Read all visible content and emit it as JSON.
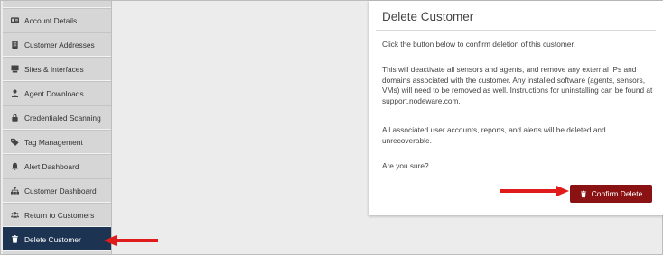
{
  "sidebar": {
    "items": [
      {
        "label": "Account Details",
        "icon": "id-card-icon"
      },
      {
        "label": "Customer Addresses",
        "icon": "document-icon"
      },
      {
        "label": "Sites & Interfaces",
        "icon": "server-icon"
      },
      {
        "label": "Agent Downloads",
        "icon": "user-icon"
      },
      {
        "label": "Credentialed Scanning",
        "icon": "lock-icon"
      },
      {
        "label": "Tag Management",
        "icon": "tags-icon"
      },
      {
        "label": "Alert Dashboard",
        "icon": "bell-icon"
      },
      {
        "label": "Customer Dashboard",
        "icon": "sitemap-icon"
      },
      {
        "label": "Return to Customers",
        "icon": "users-icon"
      },
      {
        "label": "Delete Customer",
        "icon": "trash-icon",
        "active": true
      }
    ],
    "active_color": "#1d3352"
  },
  "panel": {
    "title": "Delete Customer",
    "intro": "Click the button below to confirm deletion of this customer.",
    "warning_prefix": "This will deactivate all sensors and agents, and remove any external IPs and domains associated with the customer. Any installed software (agents, sensors, VMs) will need to be removed as well. Instructions for uninstalling can be found at ",
    "support_link": "support.nodeware.com",
    "warning_suffix": ".",
    "data_loss": "All associated user accounts, reports, and alerts will be deleted and unrecoverable.",
    "question": "Are you sure?",
    "confirm_label": "Confirm Delete",
    "confirm_color": "#8b1212"
  },
  "annotations": {
    "arrow_color": "#e01b1b"
  }
}
